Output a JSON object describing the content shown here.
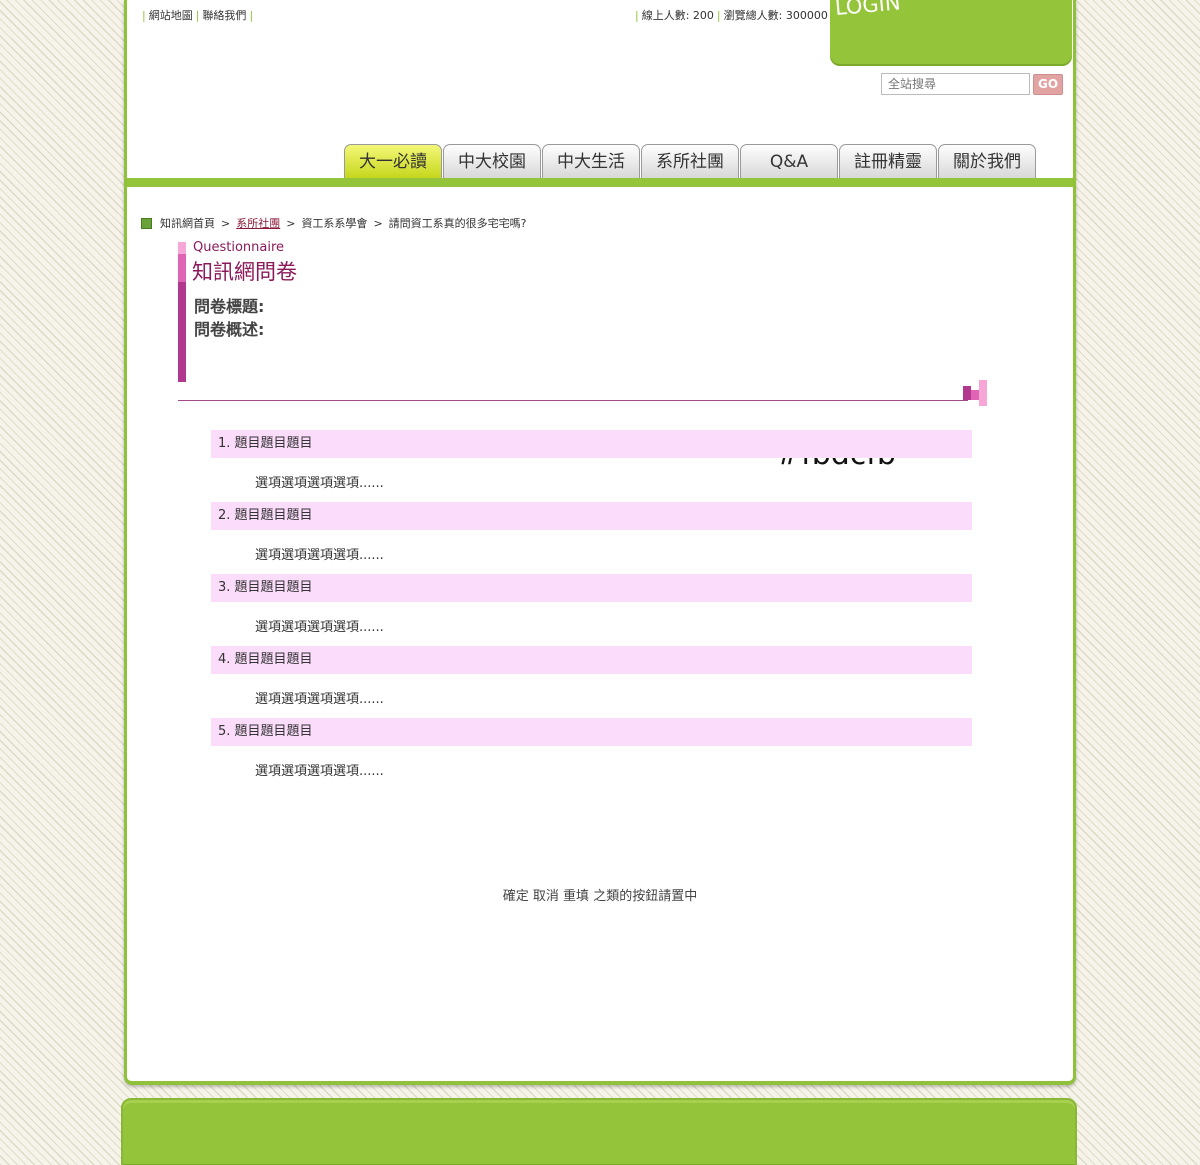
{
  "header": {
    "left_links": [
      "網站地圖",
      "聯絡我們"
    ],
    "stats": [
      "線上人數: 200",
      "瀏覽總人數: 300000"
    ],
    "login_label": "LOGIN"
  },
  "search": {
    "placeholder": "全站搜尋",
    "go_label": "GO"
  },
  "nav": {
    "tabs": [
      {
        "label": "大一必讀",
        "active": true
      },
      {
        "label": "中大校園"
      },
      {
        "label": "中大生活"
      },
      {
        "label": "系所社團"
      },
      {
        "label": "Q&A"
      },
      {
        "label": "註冊精靈"
      },
      {
        "label": "關於我們"
      }
    ]
  },
  "breadcrumb": {
    "items": [
      "知訊網首頁",
      "系所社團",
      "資工系系學會",
      "請問資工系真的很多宅宅嗎?"
    ],
    "separator": ">"
  },
  "questionnaire": {
    "title_en": "Questionnaire",
    "title_zh": "知訊網問卷",
    "title_label": "問卷標題:",
    "desc_label": "問卷概述:"
  },
  "color_note": "#fbdcfb",
  "questions": [
    {
      "label": "1. 題目題目題目",
      "option": "選項選項選項選項......"
    },
    {
      "label": "2. 題目題目題目",
      "option": "選項選項選項選項......"
    },
    {
      "label": "3. 題目題目題目",
      "option": "選項選項選項選項......"
    },
    {
      "label": "4. 題目題目題目",
      "option": "選項選項選項選項......"
    },
    {
      "label": "5. 題目題目題目",
      "option": "選項選項選項選項......"
    }
  ],
  "buttons_note": "確定 取消 重填 之類的按鈕請置中",
  "colors": {
    "brand_green": "#94c43a",
    "question_bg": "#fbdcfb",
    "title_purple": "#8b1a5a"
  }
}
